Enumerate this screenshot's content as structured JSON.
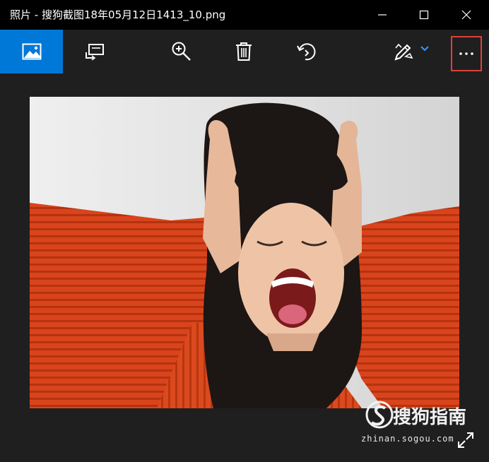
{
  "window": {
    "title": "照片 - 搜狗截图18年05月12日1413_10.png"
  },
  "toolbar": {
    "buttons": [
      {
        "name": "collection",
        "icon": "image-icon"
      },
      {
        "name": "slideshow",
        "icon": "slideshow-icon"
      },
      {
        "name": "zoom",
        "icon": "zoom-in-icon"
      },
      {
        "name": "delete",
        "icon": "trash-icon"
      },
      {
        "name": "rotate",
        "icon": "rotate-icon"
      },
      {
        "name": "edit-create",
        "icon": "edit-pencil-icon"
      },
      {
        "name": "more",
        "icon": "more-icon"
      }
    ],
    "more_label": "···"
  },
  "colors": {
    "accent": "#0078d7",
    "highlight": "#e0403a",
    "background": "#1f1f1f",
    "titlebar": "#000000"
  },
  "watermark": {
    "brand": "搜狗指南",
    "url": "zhinan.sogou.com"
  }
}
